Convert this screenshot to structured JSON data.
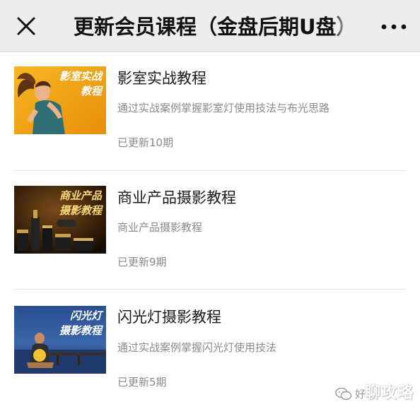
{
  "header": {
    "title": "更新会员课程（金盘后期U盘）"
  },
  "courses": [
    {
      "title": "影室实战教程",
      "description": "通过实战案例掌握影室灯使用技法与布光思路",
      "status": "已更新10期",
      "thumbnail_text": [
        "影室实战",
        "教程"
      ],
      "thumbnail_colors": {
        "bg": "#f2a516",
        "text": "#ffffff"
      }
    },
    {
      "title": "商业产品摄影教程",
      "description": "商业产品摄影教程",
      "status": "已更新9期",
      "thumbnail_text": [
        "商业产品",
        "摄影教程"
      ],
      "thumbnail_colors": {
        "bg": "#2a1a0c",
        "text": "#f5d77a"
      }
    },
    {
      "title": "闪光灯摄影教程",
      "description": "通过实战案例掌握闪光灯使用技法",
      "status": "已更新5期",
      "thumbnail_text": [
        "闪光灯",
        "摄影教程"
      ],
      "thumbnail_colors": {
        "bg": "#2a4f92",
        "text": "#ffffff"
      }
    }
  ],
  "watermark": {
    "small_text": "好",
    "big_text": "聊攻略"
  },
  "colors": {
    "header_bg": "#ededed",
    "text_primary": "#1a1a1a",
    "text_secondary": "#8a8a8a",
    "divider": "#e6e6e6"
  }
}
